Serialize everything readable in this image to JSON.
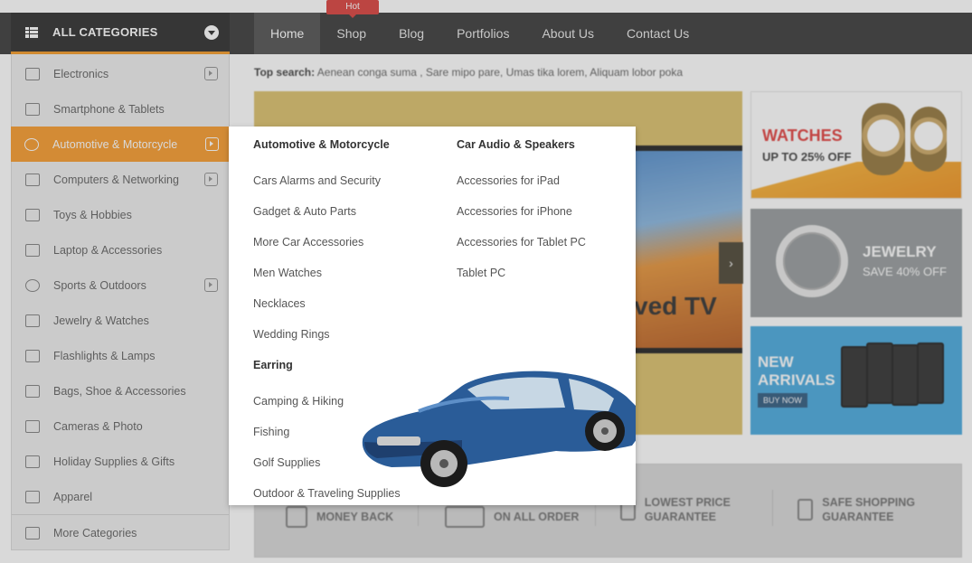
{
  "header": {
    "categories_title": "ALL CATEGORIES",
    "nav": [
      "Home",
      "Shop",
      "Blog",
      "Portfolios",
      "About Us",
      "Contact Us"
    ],
    "hot_badge": "Hot"
  },
  "sidebar": {
    "items": [
      {
        "label": "Electronics",
        "icon": "speaker-icon"
      },
      {
        "label": "Smartphone & Tablets",
        "icon": "laptop-icon"
      },
      {
        "label": "Automotive & Motorcycle",
        "icon": "car-icon"
      },
      {
        "label": "Computers & Networking",
        "icon": "monitor-icon"
      },
      {
        "label": "Toys & Hobbies",
        "icon": "toy-gun-icon"
      },
      {
        "label": "Laptop & Accessories",
        "icon": "laptop-icon"
      },
      {
        "label": "Sports & Outdoors",
        "icon": "sports-icon"
      },
      {
        "label": "Jewelry & Watches",
        "icon": "diamond-icon"
      },
      {
        "label": "Flashlights & Lamps",
        "icon": "flashlight-icon"
      },
      {
        "label": "Bags, Shoe & Accessories",
        "icon": "bag-icon"
      },
      {
        "label": "Cameras & Photo",
        "icon": "camera-icon"
      },
      {
        "label": "Holiday Supplies & Gifts",
        "icon": "gift-icon"
      },
      {
        "label": "Apparel",
        "icon": "shirt-icon"
      }
    ],
    "more_label": "More Categories"
  },
  "top_search": {
    "label": "Top search:",
    "terms": "Aenean conga suma , Sare mipo pare, Umas tika lorem, Aliquam lobor poka"
  },
  "mega_menu": {
    "col1_head": "Automotive & Motorcycle",
    "col1_links": [
      "Cars Alarms and Security",
      "Gadget & Auto Parts",
      "More Car Accessories",
      "Men Watches",
      "Necklaces",
      "Wedding Rings"
    ],
    "col2_head": "Car Audio & Speakers",
    "col2_links": [
      "Accessories for iPad",
      "Accessories for iPhone",
      "Accessories for Tablet PC",
      "Tablet PC"
    ],
    "col3_head": "Earring",
    "col3_links": [
      "Camping & Hiking",
      "Fishing",
      "Golf Supplies",
      "Outdoor & Traveling Supplies"
    ]
  },
  "slider": {
    "tv_text": "ved TV"
  },
  "banners": {
    "watch_title": "WATCHES",
    "watch_offer": "UP TO 25% OFF",
    "jewel_title": "JEWELRY",
    "jewel_offer": "SAVE 40% OFF",
    "phone_title": "NEW ARRIVALS",
    "phone_buy": "BUY NOW"
  },
  "policy": {
    "items": [
      "MONEY BACK",
      "ON ALL ORDER",
      "LOWEST PRICE GUARANTEE",
      "SAFE SHOPPING GUARANTEE"
    ]
  },
  "colors": {
    "accent": "#f7941d",
    "nav_bg": "#2b2b2b",
    "hot": "#d7332e"
  }
}
